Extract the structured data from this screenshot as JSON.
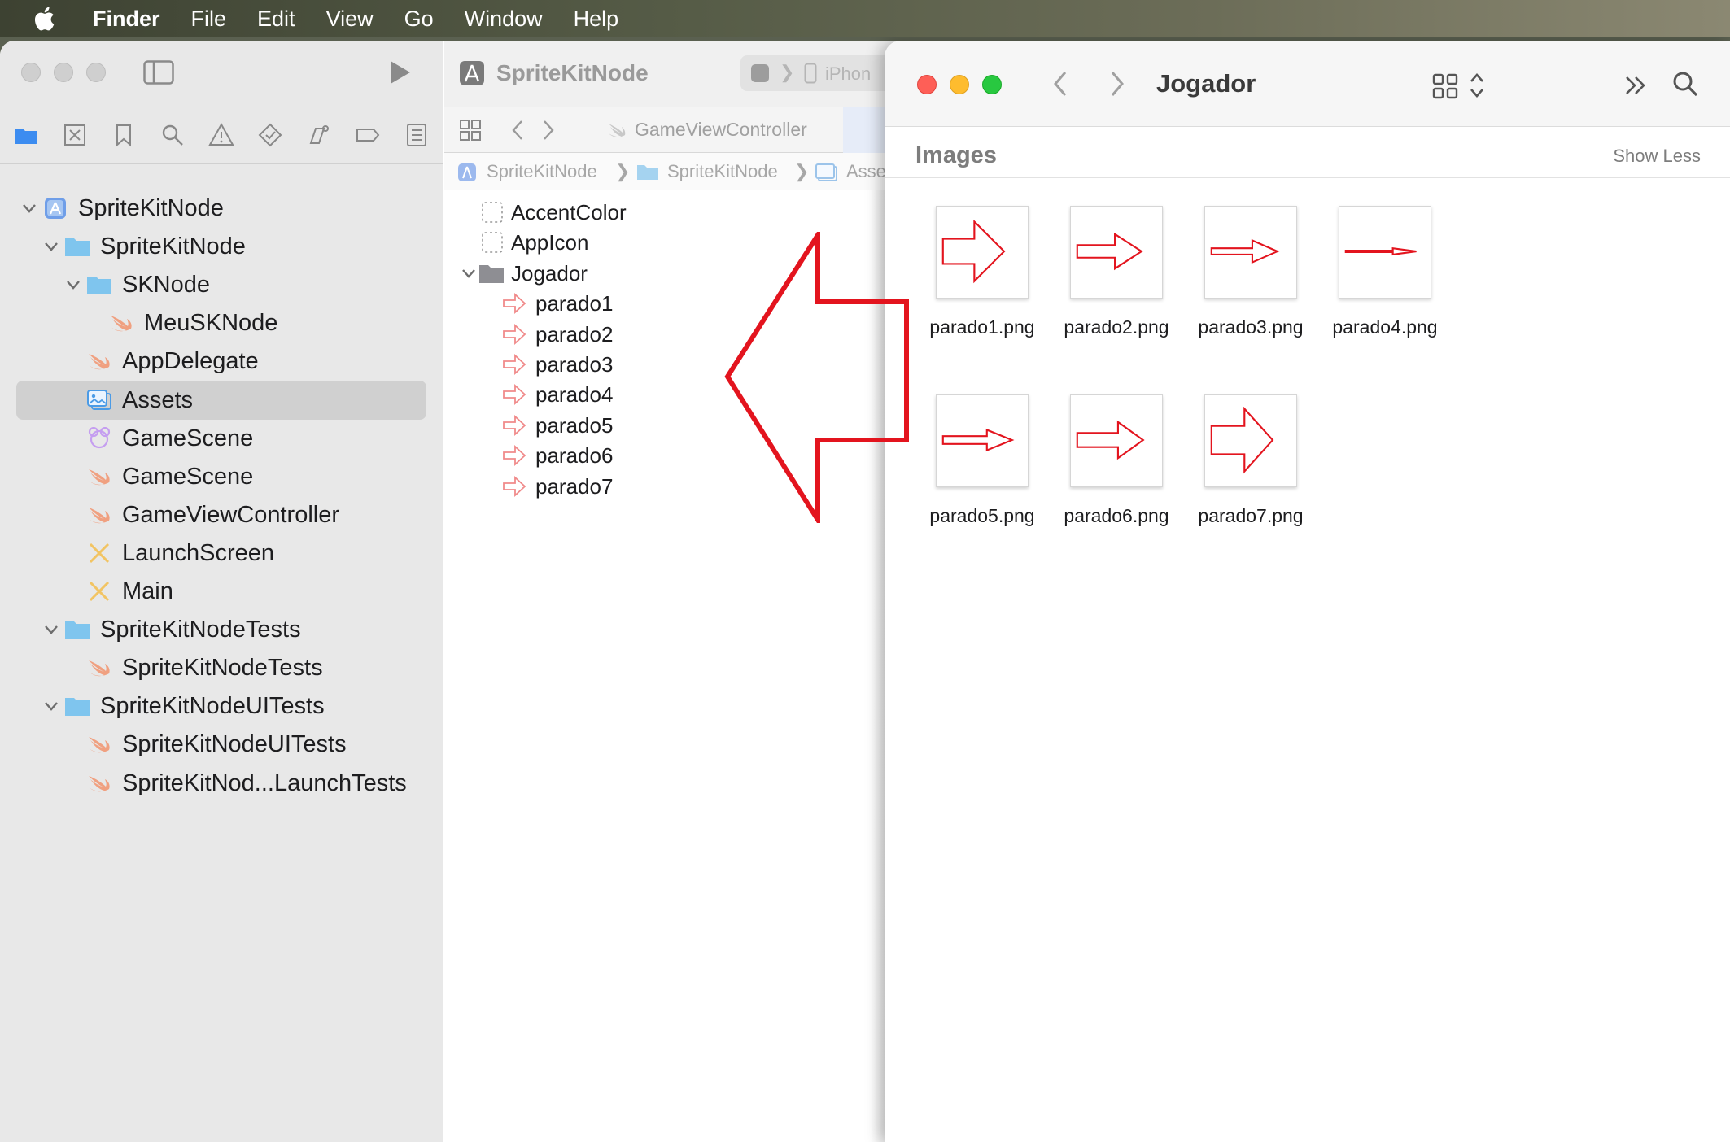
{
  "menubar": {
    "items": [
      "Finder",
      "File",
      "Edit",
      "View",
      "Go",
      "Window",
      "Help"
    ]
  },
  "xcode": {
    "project_name": "SpriteKitNode",
    "device_partial": "iPhon",
    "tab_label": "GameViewController",
    "jumpbar": [
      "SpriteKitNode",
      "SpriteKitNode",
      "Asse"
    ],
    "navigator": [
      {
        "label": "SpriteKitNode",
        "level": 0,
        "icon": "project-icon",
        "chevron": true
      },
      {
        "label": "SpriteKitNode",
        "level": 1,
        "icon": "folder-icon",
        "chevron": true
      },
      {
        "label": "SKNode",
        "level": 2,
        "icon": "folder-icon",
        "chevron": true
      },
      {
        "label": "MeuSKNode",
        "level": 3,
        "icon": "swift-icon",
        "chevron": false
      },
      {
        "label": "AppDelegate",
        "level": 2,
        "icon": "swift-icon",
        "chevron": false
      },
      {
        "label": "Assets",
        "level": 2,
        "icon": "assets-icon",
        "chevron": false,
        "selected": true
      },
      {
        "label": "GameScene",
        "level": 2,
        "icon": "scene-icon",
        "chevron": false
      },
      {
        "label": "GameScene",
        "level": 2,
        "icon": "swift-icon",
        "chevron": false
      },
      {
        "label": "GameViewController",
        "level": 2,
        "icon": "swift-icon",
        "chevron": false
      },
      {
        "label": "LaunchScreen",
        "level": 2,
        "icon": "storyboard-icon",
        "chevron": false
      },
      {
        "label": "Main",
        "level": 2,
        "icon": "storyboard-icon",
        "chevron": false
      },
      {
        "label": "SpriteKitNodeTests",
        "level": 1,
        "icon": "folder-icon",
        "chevron": true
      },
      {
        "label": "SpriteKitNodeTests",
        "level": 2,
        "icon": "swift-icon",
        "chevron": false
      },
      {
        "label": "SpriteKitNodeUITests",
        "level": 1,
        "icon": "folder-icon",
        "chevron": true
      },
      {
        "label": "SpriteKitNodeUITests",
        "level": 2,
        "icon": "swift-icon",
        "chevron": false
      },
      {
        "label": "SpriteKitNod...LaunchTests",
        "level": 2,
        "icon": "swift-icon",
        "chevron": false
      }
    ],
    "assets": [
      {
        "label": "AccentColor",
        "icon": "color-set-icon",
        "indent": 0
      },
      {
        "label": "AppIcon",
        "icon": "appicon-set-icon",
        "indent": 0
      },
      {
        "label": "Jogador",
        "icon": "folder-icon",
        "indent": 0,
        "chevron": true
      },
      {
        "label": "parado1",
        "icon": "arrow-image-icon",
        "indent": 1
      },
      {
        "label": "parado2",
        "icon": "arrow-image-icon",
        "indent": 1
      },
      {
        "label": "parado3",
        "icon": "arrow-image-icon",
        "indent": 1
      },
      {
        "label": "parado4",
        "icon": "arrow-image-icon",
        "indent": 1
      },
      {
        "label": "parado5",
        "icon": "arrow-image-icon",
        "indent": 1
      },
      {
        "label": "parado6",
        "icon": "arrow-image-icon",
        "indent": 1
      },
      {
        "label": "parado7",
        "icon": "arrow-image-icon",
        "indent": 1
      }
    ]
  },
  "finder": {
    "title": "Jogador",
    "section_title": "Images",
    "show_less": "Show Less",
    "files": [
      "parado1.png",
      "parado2.png",
      "parado3.png",
      "parado4.png",
      "parado5.png",
      "parado6.png",
      "parado7.png"
    ]
  },
  "colors": {
    "arrow_red": "#e3141e",
    "close": "#fe5f57",
    "minimize": "#febc2e",
    "zoom": "#28c840",
    "folder_blue": "#7fc5ee",
    "swift_orange": "#f0a080"
  }
}
